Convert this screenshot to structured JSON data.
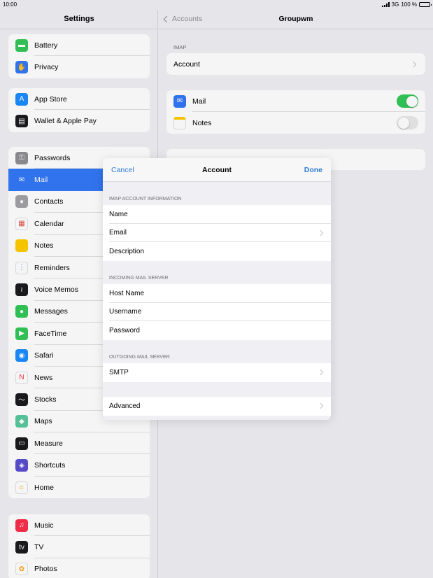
{
  "status": {
    "time": "10:00",
    "network": "3G",
    "battery": "100 %"
  },
  "sidebar": {
    "title": "Settings",
    "groups": [
      [
        {
          "label": "Battery",
          "icon": "battery-icon",
          "color": "#34c759"
        },
        {
          "label": "Privacy",
          "icon": "hand-icon",
          "color": "#3478f6"
        }
      ],
      [
        {
          "label": "App Store",
          "icon": "app-store-icon",
          "color": "#1a8cff"
        },
        {
          "label": "Wallet & Apple Pay",
          "icon": "wallet-icon",
          "color": "#1c1c1e"
        }
      ],
      [
        {
          "label": "Passwords",
          "icon": "key-icon",
          "color": "#8e8e93"
        },
        {
          "label": "Mail",
          "icon": "mail-icon",
          "color": "#3478f6",
          "selected": true
        },
        {
          "label": "Contacts",
          "icon": "contacts-icon",
          "color": "#a2a2a7"
        },
        {
          "label": "Calendar",
          "icon": "calendar-icon",
          "color": "#ffffff"
        },
        {
          "label": "Notes",
          "icon": "notes-icon",
          "color": "#ffcc00"
        },
        {
          "label": "Reminders",
          "icon": "reminders-icon",
          "color": "#ffffff"
        },
        {
          "label": "Voice Memos",
          "icon": "voice-memos-icon",
          "color": "#1c1c1e"
        },
        {
          "label": "Messages",
          "icon": "messages-icon",
          "color": "#34c759"
        },
        {
          "label": "FaceTime",
          "icon": "facetime-icon",
          "color": "#34c759"
        },
        {
          "label": "Safari",
          "icon": "safari-icon",
          "color": "#1a8cff"
        },
        {
          "label": "News",
          "icon": "news-icon",
          "color": "#ffffff"
        },
        {
          "label": "Stocks",
          "icon": "stocks-icon",
          "color": "#1c1c1e"
        },
        {
          "label": "Maps",
          "icon": "maps-icon",
          "color": "#5ac8a0"
        },
        {
          "label": "Measure",
          "icon": "measure-icon",
          "color": "#1c1c1e"
        },
        {
          "label": "Shortcuts",
          "icon": "shortcuts-icon",
          "color": "#5a4fcf"
        },
        {
          "label": "Home",
          "icon": "home-icon",
          "color": "#ffffff"
        }
      ],
      [
        {
          "label": "Music",
          "icon": "music-icon",
          "color": "#fa2d48"
        },
        {
          "label": "TV",
          "icon": "tv-icon",
          "color": "#1c1c1e"
        },
        {
          "label": "Photos",
          "icon": "photos-icon",
          "color": "#ffffff"
        }
      ]
    ]
  },
  "detail": {
    "back_label": "Accounts",
    "title": "Groupwm",
    "imap_header": "IMAP",
    "account_label": "Account",
    "mail_label": "Mail",
    "mail_on": true,
    "notes_label": "Notes",
    "notes_on": false
  },
  "modal": {
    "cancel": "Cancel",
    "title": "Account",
    "done": "Done",
    "sections": [
      {
        "header": "IMAP ACCOUNT INFORMATION",
        "rows": [
          {
            "label": "Name",
            "chevron": false
          },
          {
            "label": "Email",
            "chevron": true
          },
          {
            "label": "Description",
            "chevron": false
          }
        ]
      },
      {
        "header": "INCOMING MAIL SERVER",
        "rows": [
          {
            "label": "Host Name",
            "chevron": false
          },
          {
            "label": "Username",
            "chevron": false
          },
          {
            "label": "Password",
            "chevron": false
          }
        ]
      },
      {
        "header": "OUTGOING MAIL SERVER",
        "rows": [
          {
            "label": "SMTP",
            "chevron": true
          }
        ]
      },
      {
        "header": "",
        "rows": [
          {
            "label": "Advanced",
            "chevron": true
          }
        ]
      }
    ]
  }
}
